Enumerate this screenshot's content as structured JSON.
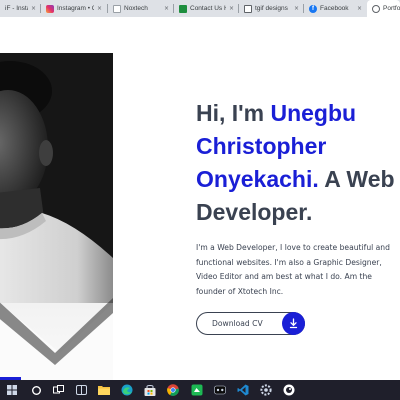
{
  "browser": {
    "tabs": [
      {
        "title": "iF - Instagra",
        "favicon": "instagram-icon"
      },
      {
        "title": "Instagram • C",
        "favicon": "instagram-icon"
      },
      {
        "title": "Noxtech",
        "favicon": "page-icon"
      },
      {
        "title": "Contact Us H",
        "favicon": "contact-icon"
      },
      {
        "title": "tgif designs",
        "favicon": "tgif-icon"
      },
      {
        "title": "Facebook",
        "favicon": "facebook-icon"
      },
      {
        "title": "Portfoli",
        "favicon": "globe-icon",
        "active": true
      }
    ],
    "close_glyph": "×"
  },
  "hero": {
    "greeting": "Hi, I'm",
    "name_line1": "Unegbu",
    "name_line2": "Christopher",
    "name_line3": "Onyekachi.",
    "role_lead": "A Web",
    "role_tail": "Developer.",
    "intro_lines": [
      "I'm a Web Developer, I love to create beautiful and",
      "functional websites. I'm also a Graphic Designer,",
      "Video Editor and am best at what I do. Am the",
      "founder of Xtotech Inc."
    ],
    "cta_label": "Download CV"
  },
  "colors": {
    "accent": "#1a1fd6",
    "text": "#3a4251",
    "taskbar": "#1f1f2b"
  },
  "taskbar": {
    "icons": [
      "start-icon",
      "search-icon",
      "task-view-icon",
      "widgets-icon",
      "file-explorer-icon",
      "edge-icon",
      "chrome-icon",
      "ms-store-icon",
      "vscode-icon",
      "photos-icon",
      "settings-icon",
      "browser-icon"
    ]
  }
}
